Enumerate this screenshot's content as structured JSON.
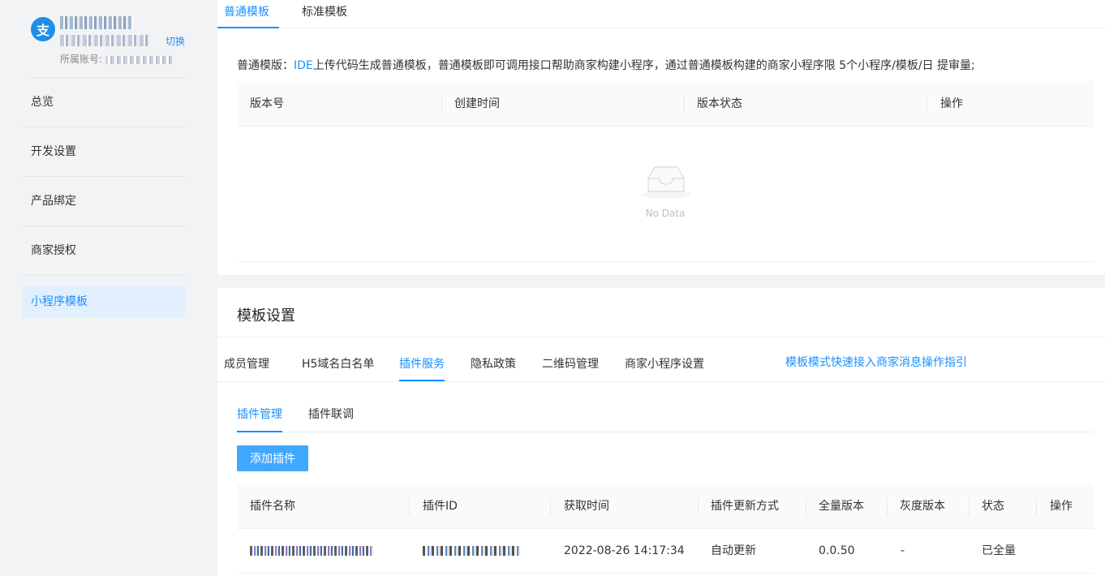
{
  "sidebar": {
    "account_switch": "切换",
    "account_belong_label": "所属账号:",
    "items": [
      {
        "label": "总览"
      },
      {
        "label": "开发设置"
      },
      {
        "label": "产品绑定"
      },
      {
        "label": "商家授权"
      },
      {
        "label": "小程序模板"
      }
    ]
  },
  "template_card": {
    "tabs": [
      "普通模板",
      "标准模板"
    ],
    "description_prefix": "普通模版：",
    "description_link": "IDE",
    "description_suffix": "上传代码生成普通模板，普通模板即可调用接口帮助商家构建小程序，通过普通模板构建的商家小程序限 5个小程序/模板/日 提审量;",
    "columns": [
      "版本号",
      "创建时间",
      "版本状态",
      "操作"
    ],
    "empty_text": "No Data"
  },
  "settings_card": {
    "title": "模板设置",
    "tabs": [
      "成员管理",
      "H5域名白名单",
      "插件服务",
      "隐私政策",
      "二维码管理",
      "商家小程序设置"
    ],
    "guide_link": "模板模式快速接入商家消息操作指引",
    "sub_tabs": [
      "插件管理",
      "插件联调"
    ],
    "add_button": "添加插件",
    "columns": [
      "插件名称",
      "插件ID",
      "获取时间",
      "插件更新方式",
      "全量版本",
      "灰度版本",
      "状态",
      "操作"
    ],
    "rows": [
      {
        "get_time": "2022-08-26 14:17:34",
        "update_mode": "自动更新",
        "full_version": "0.0.50",
        "gray_version": "-",
        "status": "已全量"
      }
    ]
  },
  "colors": {
    "accent": "#1890ff",
    "button": "#40a9ff",
    "active_nav_bg": "#e1efff"
  }
}
